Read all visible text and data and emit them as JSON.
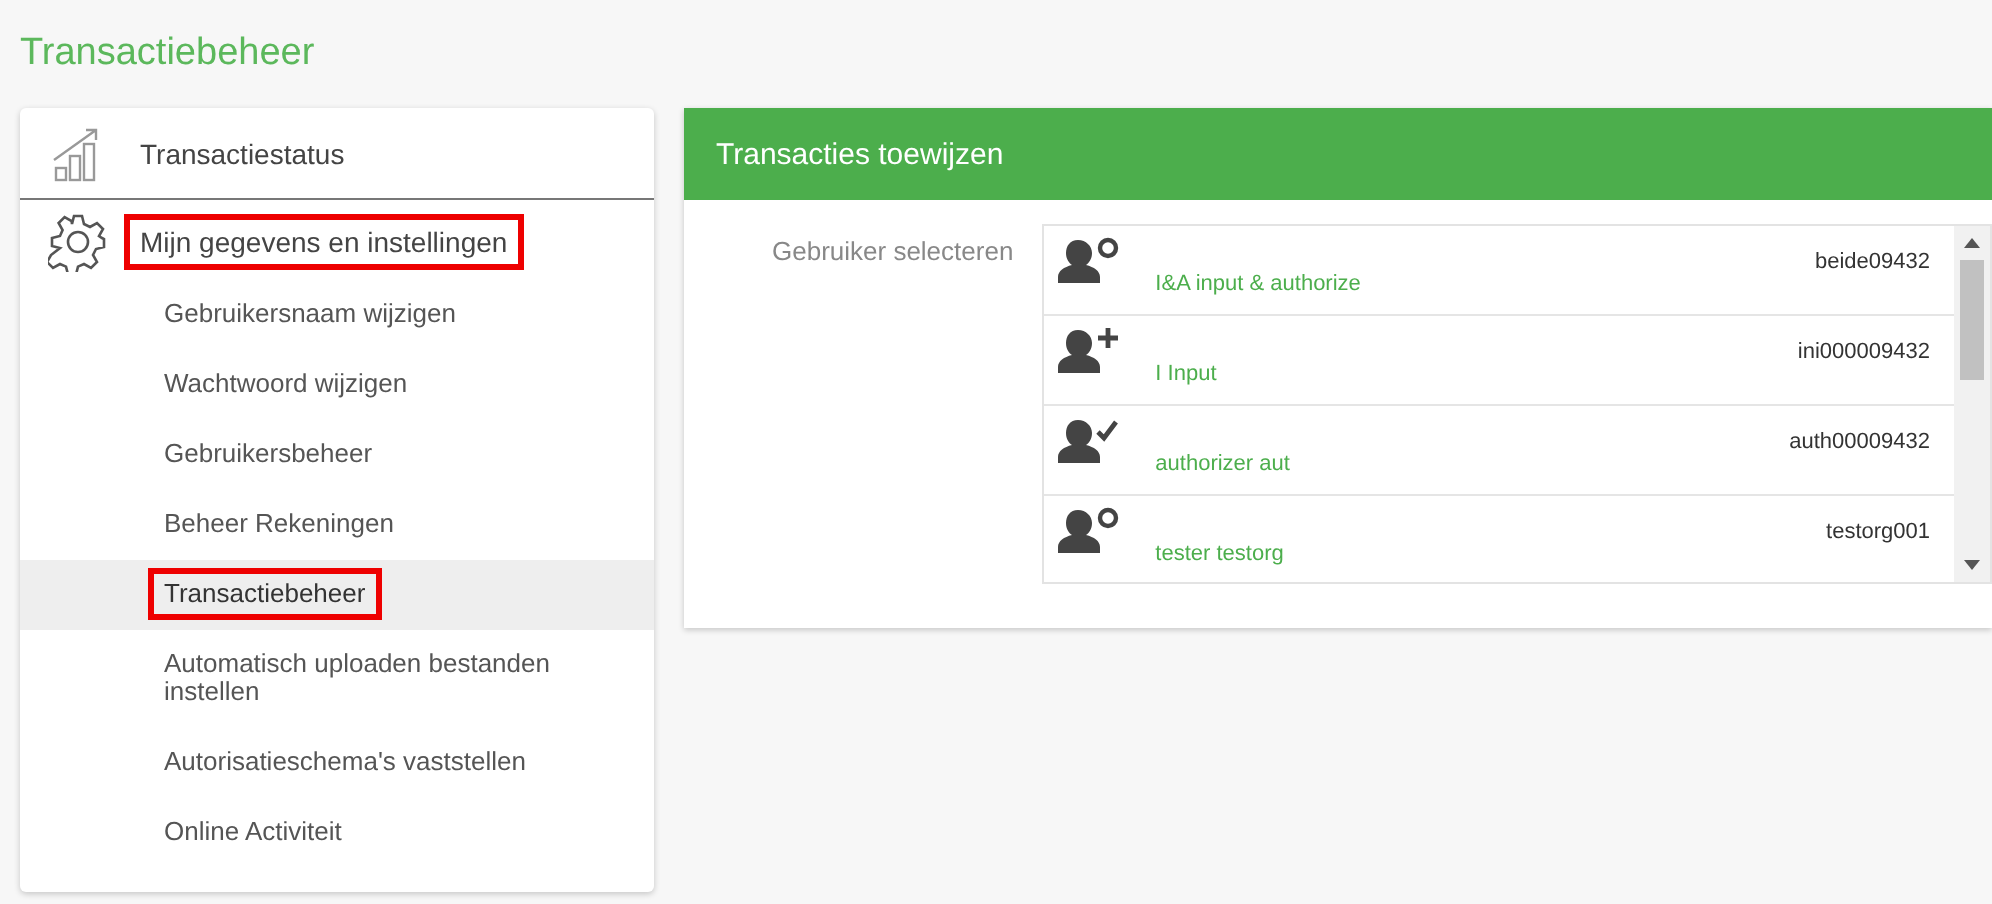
{
  "page_title": "Transactiebeheer",
  "sidebar": {
    "sections": [
      {
        "kind": "chart",
        "label": "Transactiestatus",
        "highlighted": false
      },
      {
        "kind": "gear",
        "label": "Mijn gegevens en instellingen",
        "highlighted": true,
        "items": [
          {
            "label": "Gebruikersnaam wijzigen",
            "selected": false,
            "highlighted": false
          },
          {
            "label": "Wachtwoord wijzigen",
            "selected": false,
            "highlighted": false
          },
          {
            "label": "Gebruikersbeheer",
            "selected": false,
            "highlighted": false
          },
          {
            "label": "Beheer Rekeningen",
            "selected": false,
            "highlighted": false
          },
          {
            "label": "Transactiebeheer",
            "selected": true,
            "highlighted": true
          },
          {
            "label": "Automatisch uploaden bestanden instellen",
            "selected": false,
            "highlighted": false
          },
          {
            "label": "Autorisatieschema's vaststellen",
            "selected": false,
            "highlighted": false
          },
          {
            "label": "Online Activiteit",
            "selected": false,
            "highlighted": false
          }
        ]
      }
    ]
  },
  "panel": {
    "title": "Transacties toewijzen",
    "field_label": "Gebruiker selecteren",
    "users": [
      {
        "kind": "both",
        "name": "I&A input & authorize",
        "id": "beide09432"
      },
      {
        "kind": "input",
        "name": "I Input",
        "id": "ini000009432"
      },
      {
        "kind": "authorizer",
        "name": "authorizer aut",
        "id": "auth00009432"
      },
      {
        "kind": "both",
        "name": "tester testorg",
        "id": "testorg001"
      }
    ]
  }
}
